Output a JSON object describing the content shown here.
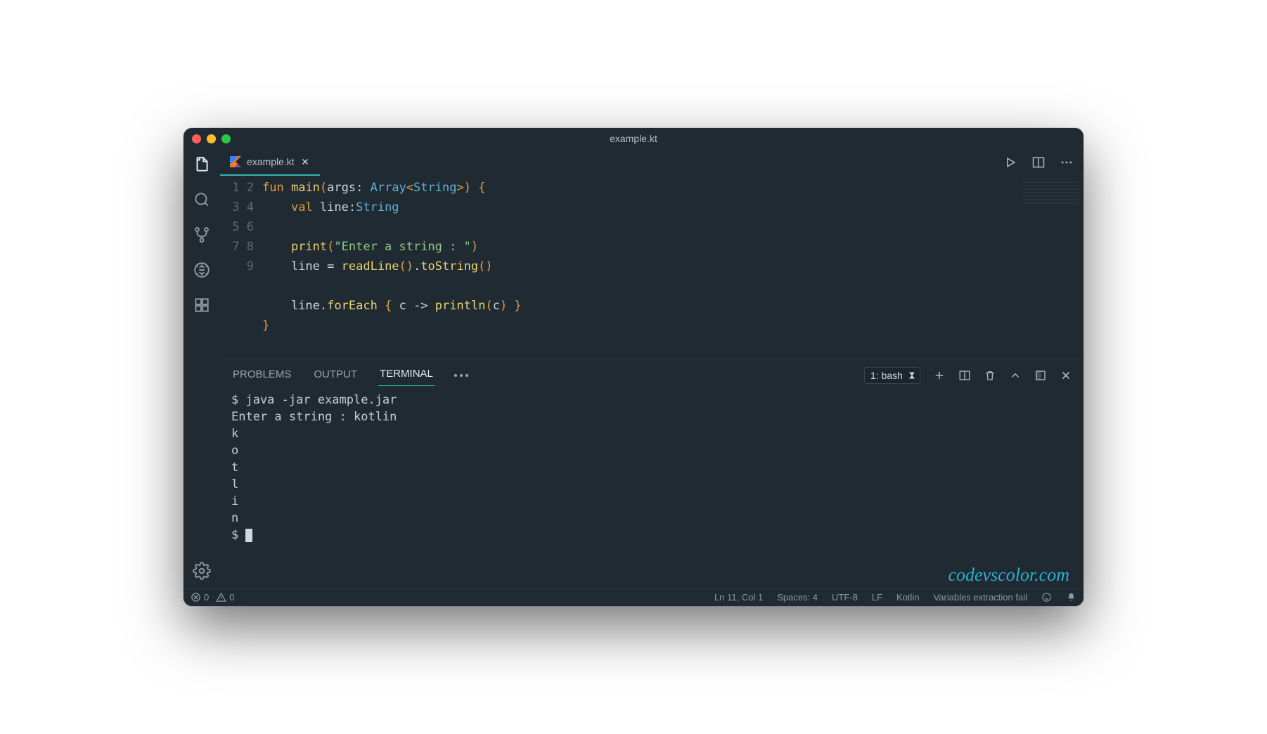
{
  "window": {
    "title": "example.kt"
  },
  "tab": {
    "filename": "example.kt"
  },
  "code": {
    "lines": [
      "1",
      "2",
      "3",
      "4",
      "5",
      "6",
      "7",
      "8",
      "9"
    ],
    "l1_fun": "fun",
    "l1_main": "main",
    "l1_args": "args",
    "l1_array": "Array",
    "l1_string": "String",
    "l2_val": "val",
    "l2_line": "line",
    "l2_type": "String",
    "l4_print": "print",
    "l4_str": "\"Enter a string : \"",
    "l5_line": "line",
    "l5_read": "readLine",
    "l5_tostr": "toString",
    "l7_line": "line",
    "l7_foreach": "forEach",
    "l7_c": "c",
    "l7_println": "println",
    "l7_c2": "c"
  },
  "panel": {
    "tabs": {
      "problems": "PROBLEMS",
      "output": "OUTPUT",
      "terminal": "TERMINAL"
    },
    "term_select": "1: bash"
  },
  "terminal": {
    "l1": "$ java -jar example.jar",
    "l2": "Enter a string : kotlin",
    "l3": "k",
    "l4": "o",
    "l5": "t",
    "l6": "l",
    "l7": "i",
    "l8": "n",
    "l9": "$ "
  },
  "watermark": "codevscolor.com",
  "status": {
    "errors": "0",
    "warnings": "0",
    "position": "Ln 11, Col 1",
    "spaces": "Spaces: 4",
    "encoding": "UTF-8",
    "eol": "LF",
    "language": "Kotlin",
    "extraction": "Variables extraction fail"
  }
}
